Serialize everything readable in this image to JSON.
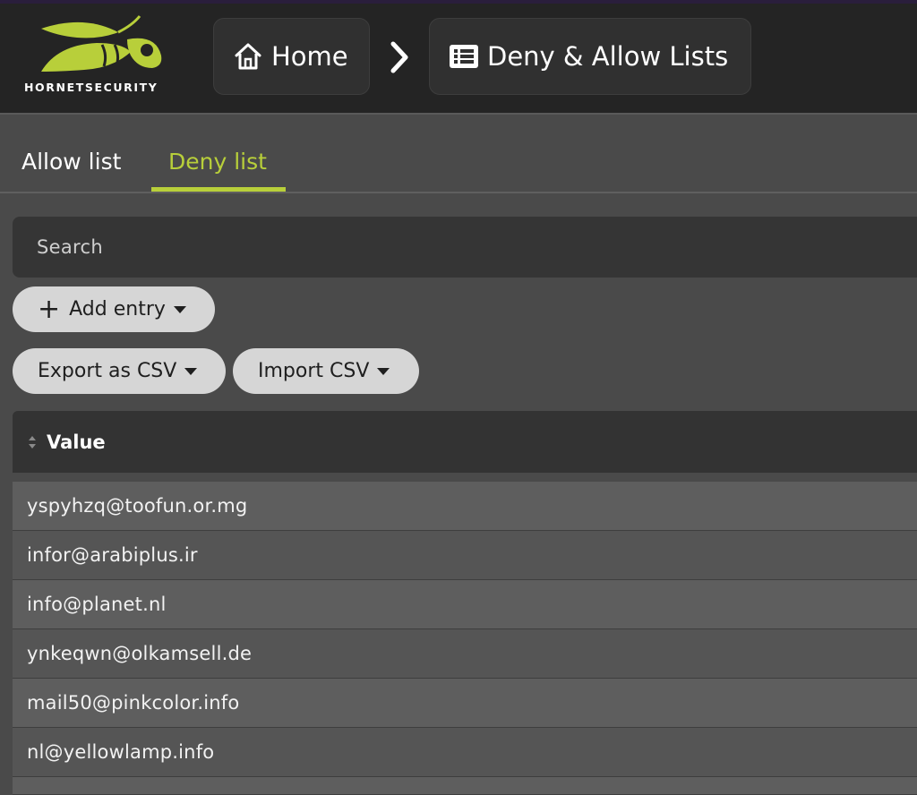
{
  "header": {
    "logo_text": "HORNETSECURITY",
    "breadcrumbs": [
      {
        "label": "Home",
        "icon": "home-icon"
      },
      {
        "label": "Deny & Allow Lists",
        "icon": "list-icon"
      }
    ],
    "separator_icon": "chevron-right-icon"
  },
  "tabs": [
    {
      "label": "Allow list",
      "active": false
    },
    {
      "label": "Deny list",
      "active": true
    }
  ],
  "search": {
    "placeholder": "Search"
  },
  "actions": {
    "add_entry": "Add entry",
    "export_csv": "Export as CSV",
    "import_csv": "Import CSV"
  },
  "table": {
    "columns": [
      "Value"
    ],
    "rows": [
      "yspyhzq@toofun.or.mg",
      "infor@arabiplus.ir",
      "info@planet.nl",
      "ynkeqwn@olkamsell.de",
      "mail50@pinkcolor.info",
      "nl@yellowlamp.info"
    ]
  },
  "colors": {
    "accent": "#b8cf3a",
    "header_bg": "#242424",
    "page_bg": "#4a4a4a"
  }
}
